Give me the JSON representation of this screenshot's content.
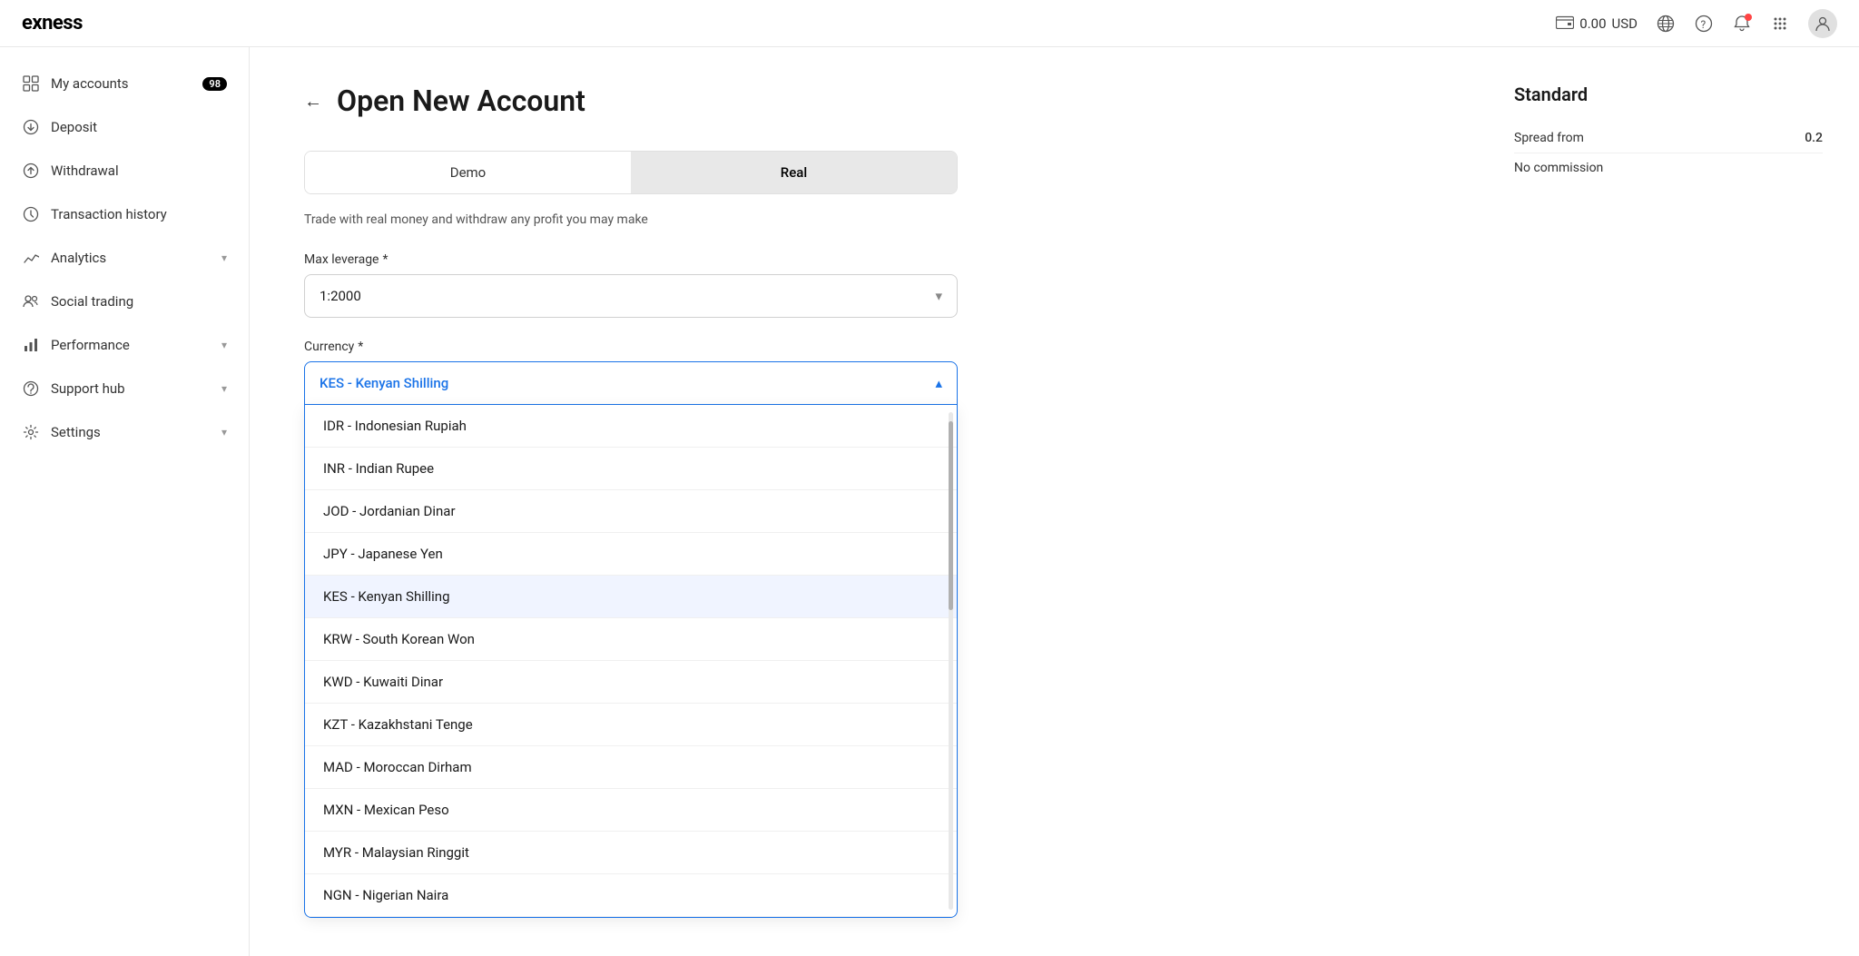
{
  "header": {
    "logo": "exness",
    "balance": "0.00",
    "currency": "USD",
    "icons": {
      "wallet": "💳",
      "globe": "🌐",
      "help": "?",
      "bell": "🔔",
      "grid": "⊞"
    }
  },
  "sidebar": {
    "items": [
      {
        "id": "my-accounts",
        "label": "My accounts",
        "badge": "98",
        "icon": "grid",
        "active": false
      },
      {
        "id": "deposit",
        "label": "Deposit",
        "icon": "arrow-down",
        "active": false
      },
      {
        "id": "withdrawal",
        "label": "Withdrawal",
        "icon": "arrow-up",
        "active": false
      },
      {
        "id": "transaction-history",
        "label": "Transaction history",
        "icon": "clock",
        "active": false
      },
      {
        "id": "analytics",
        "label": "Analytics",
        "icon": "chart",
        "active": false,
        "hasChevron": true
      },
      {
        "id": "social-trading",
        "label": "Social trading",
        "icon": "people",
        "active": false
      },
      {
        "id": "performance",
        "label": "Performance",
        "icon": "bar",
        "active": false,
        "hasChevron": true
      },
      {
        "id": "support-hub",
        "label": "Support hub",
        "icon": "headset",
        "active": false,
        "hasChevron": true
      },
      {
        "id": "settings",
        "label": "Settings",
        "icon": "gear",
        "active": false,
        "hasChevron": true
      }
    ]
  },
  "page": {
    "title": "Open New Account",
    "back_label": "←",
    "tabs": [
      {
        "id": "demo",
        "label": "Demo",
        "active": false
      },
      {
        "id": "real",
        "label": "Real",
        "active": true
      }
    ],
    "description": "Trade with real money and withdraw any profit you may make",
    "leverage": {
      "label": "Max leverage",
      "required": true,
      "value": "1:2000"
    },
    "currency": {
      "label": "Currency",
      "required": true,
      "selected": "KES - Kenyan Shilling",
      "options": [
        {
          "id": "IDR",
          "label": "IDR - Indonesian Rupiah",
          "selected": false
        },
        {
          "id": "INR",
          "label": "INR - Indian Rupee",
          "selected": false
        },
        {
          "id": "JOD",
          "label": "JOD - Jordanian Dinar",
          "selected": false
        },
        {
          "id": "JPY",
          "label": "JPY - Japanese Yen",
          "selected": false
        },
        {
          "id": "KES",
          "label": "KES - Kenyan Shilling",
          "selected": true
        },
        {
          "id": "KRW",
          "label": "KRW - South Korean Won",
          "selected": false
        },
        {
          "id": "KWD",
          "label": "KWD - Kuwaiti Dinar",
          "selected": false
        },
        {
          "id": "KZT",
          "label": "KZT - Kazakhstani Tenge",
          "selected": false
        },
        {
          "id": "MAD",
          "label": "MAD - Moroccan Dirham",
          "selected": false
        },
        {
          "id": "MXN",
          "label": "MXN - Mexican Peso",
          "selected": false
        },
        {
          "id": "MYR",
          "label": "MYR - Malaysian Ringgit",
          "selected": false
        },
        {
          "id": "NGN",
          "label": "NGN - Nigerian Naira",
          "selected": false
        }
      ]
    }
  },
  "right_panel": {
    "title": "Standard",
    "rows": [
      {
        "key": "Spread from",
        "value": "0.2"
      },
      {
        "key": "No commission",
        "value": ""
      }
    ]
  }
}
